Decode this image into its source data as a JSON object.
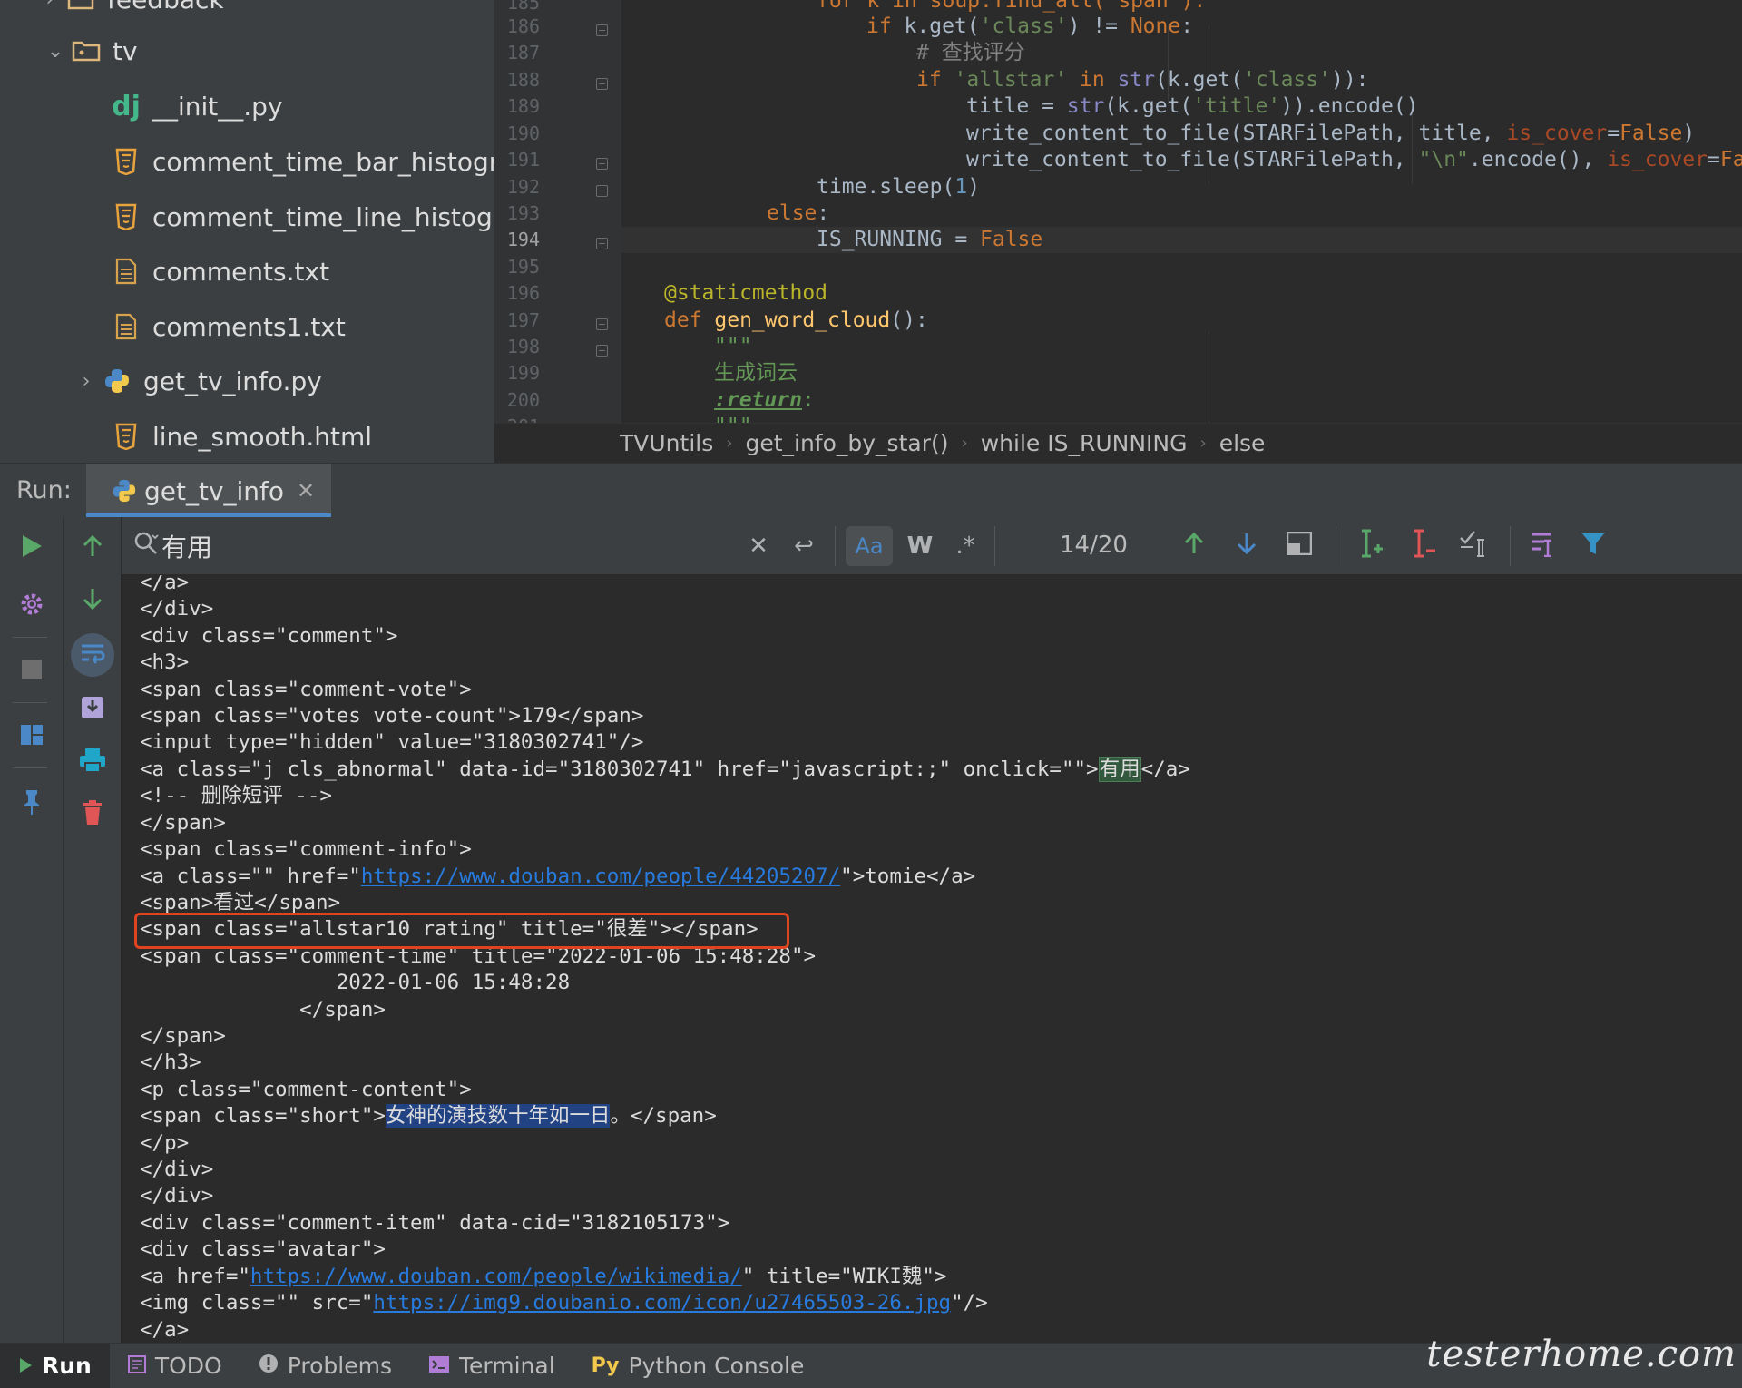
{
  "tree": {
    "items": [
      {
        "label": "feedback",
        "type": "folder",
        "collapsed": true
      },
      {
        "label": "tv",
        "type": "folder",
        "expanded": true
      },
      {
        "label": "__init__.py",
        "type": "django"
      },
      {
        "label": "comment_time_bar_histogra",
        "type": "html"
      },
      {
        "label": "comment_time_line_histogra",
        "type": "html"
      },
      {
        "label": "comments.txt",
        "type": "text"
      },
      {
        "label": "comments1.txt",
        "type": "text"
      },
      {
        "label": "get_tv_info.py",
        "type": "python"
      },
      {
        "label": "line_smooth.html",
        "type": "html"
      }
    ]
  },
  "editor": {
    "line_numbers": [
      "185",
      "186",
      "187",
      "188",
      "189",
      "190",
      "191",
      "192",
      "193",
      "194",
      "195",
      "196",
      "197",
      "198",
      "199",
      "200",
      "201"
    ],
    "active_line": "194",
    "lines": {
      "l185": "for k in soup.find_all('span'):",
      "l186a": "if ",
      "l186b": "k.get(",
      "l186c": "'class'",
      "l186d": ") != ",
      "l186e": "None",
      "l186f": ":",
      "l187": "# 查找评分",
      "l188a": "if ",
      "l188b": "'allstar'",
      "l188c": " in ",
      "l188d": "str",
      "l188e": "(k.get(",
      "l188f": "'class'",
      "l188g": ")):",
      "l189a": "title = ",
      "l189b": "str",
      "l189c": "(k.get(",
      "l189d": "'title'",
      "l189e": ")).encode()",
      "l190a": "write_content_to_file(STARFilePath, title, ",
      "l190b": "is_cover",
      "l190c": "=",
      "l190d": "False",
      "l190e": ")",
      "l191a": "write_content_to_file(STARFilePath, ",
      "l191b": "\"\\n\"",
      "l191c": ".encode(), ",
      "l191d": "is_cover",
      "l191e": "=",
      "l191f": "Fa",
      "l192a": "time.sleep(",
      "l192b": "1",
      "l192c": ")",
      "l193a": "else",
      "l193b": ":",
      "l194a": "IS_RUNNING = ",
      "l194b": "False",
      "l196": "@staticmethod",
      "l197a": "def ",
      "l197b": "gen_word_cloud",
      "l197c": "():",
      "l198": "\"\"\"",
      "l199": "生成词云",
      "l200a": ":return",
      "l200b": ":",
      "l201": "\"\"\""
    }
  },
  "breadcrumb": [
    "TVUntils",
    "get_info_by_star()",
    "while IS_RUNNING",
    "else"
  ],
  "run": {
    "label": "Run:",
    "tab_label": "get_tv_info",
    "search_value": "有用",
    "match_count": "14/20",
    "toggle_case": "Aa",
    "toggle_words": "W",
    "toggle_regex": ".*"
  },
  "console": {
    "lines": [
      "</a>",
      "</div>",
      "<div class=\"comment\">",
      "<h3>",
      "<span class=\"comment-vote\">",
      "<span class=\"votes vote-count\">179</span>",
      "<input type=\"hidden\" value=\"3180302741\"/>",
      "<a class=\"j cls_abnormal\" data-id=\"3180302741\" href=\"javascript:;\" onclick=\"\">",
      "<!-- 删除短评 -->",
      "</span>",
      "<span class=\"comment-info\">",
      "<a class=\"\" href=\"",
      "<span>看过</span>",
      "<span class=\"allstar10 rating\" title=\"很差\"></span>",
      "<span class=\"comment-time\" title=\"2022-01-06 15:48:28\">",
      "                2022-01-06 15:48:28",
      "             </span>",
      "</span>",
      "</h3>",
      "<p class=\"comment-content\">",
      "<span class=\"short\">",
      "</p>",
      "</div>",
      "</div>",
      "<div class=\"comment-item\" data-cid=\"3182105173\">",
      "<div class=\"avatar\">",
      "<a href=\"",
      "<img class=\"\" src=\"",
      "</a>"
    ],
    "match_text": "有用",
    "match_tail": "</a>",
    "link1": "https://www.douban.com/people/44205207/",
    "link1_tail": "\">tomie</a>",
    "short_text": "女神的演技数十年如一日",
    "short_tail": "。</span>",
    "link2": "https://www.douban.com/people/wikimedia/",
    "link2_tail": "\" title=\"WIKI魏\">",
    "link3": "https://img9.doubanio.com/icon/u27465503-26.jpg",
    "link3_tail": "\"/>"
  },
  "statusbar": {
    "tabs": [
      {
        "label": "Run",
        "icon": "run-icon"
      },
      {
        "label": "TODO",
        "icon": "todo-icon"
      },
      {
        "label": "Problems",
        "icon": "problems-icon"
      },
      {
        "label": "Terminal",
        "icon": "terminal-icon"
      },
      {
        "label": "Python Console",
        "icon": "python-console-icon"
      }
    ]
  },
  "watermark": "testerhome.com",
  "colors": {
    "accent_blue": "#4a88c7",
    "highlight_box": "#e0431f",
    "run_green": "#59a869",
    "stop_red": "#e05555"
  }
}
